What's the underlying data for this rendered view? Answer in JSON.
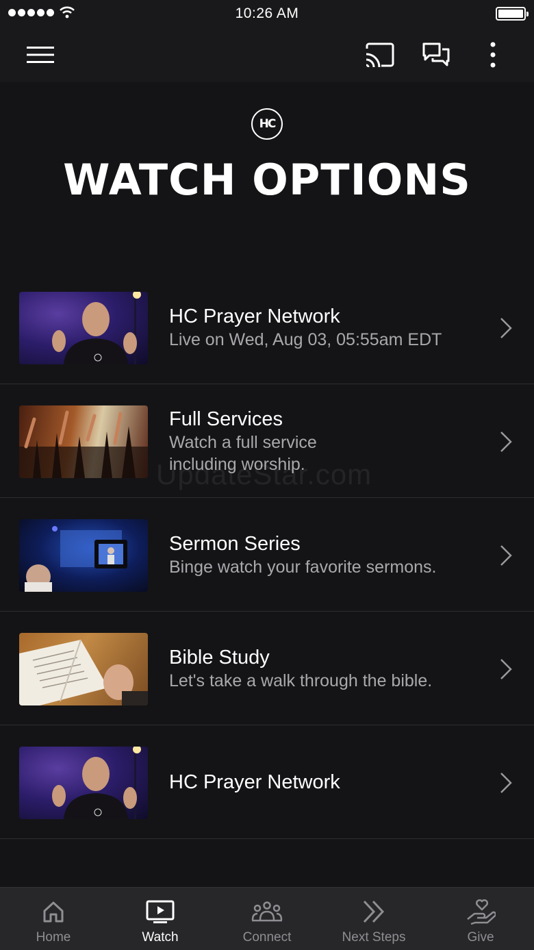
{
  "status_bar": {
    "time": "10:26 AM"
  },
  "hero": {
    "logo_text": "HC",
    "title": "WATCH OPTIONS"
  },
  "items": [
    {
      "title": "HC Prayer Network",
      "subtitle": "Live on Wed, Aug 03, 05:55am EDT",
      "thumb": "prayer"
    },
    {
      "title": "Full Services",
      "subtitle": "Watch a full service including worship.",
      "thumb": "services"
    },
    {
      "title": "Sermon Series",
      "subtitle": "Binge watch your favorite sermons.",
      "thumb": "sermon"
    },
    {
      "title": "Bible Study",
      "subtitle": "Let's take a walk through the bible.",
      "thumb": "bible"
    },
    {
      "title": "HC Prayer Network",
      "subtitle": "",
      "thumb": "prayer"
    }
  ],
  "watermark": "UpdateStar.com",
  "tabs": [
    {
      "label": "Home",
      "icon": "home-icon"
    },
    {
      "label": "Watch",
      "icon": "watch-icon",
      "active": true
    },
    {
      "label": "Connect",
      "icon": "connect-icon"
    },
    {
      "label": "Next Steps",
      "icon": "next-steps-icon"
    },
    {
      "label": "Give",
      "icon": "give-icon"
    }
  ],
  "colors": {
    "background": "#141416",
    "tab_active": "#ffffff",
    "tab_inactive": "#8f8f93"
  }
}
